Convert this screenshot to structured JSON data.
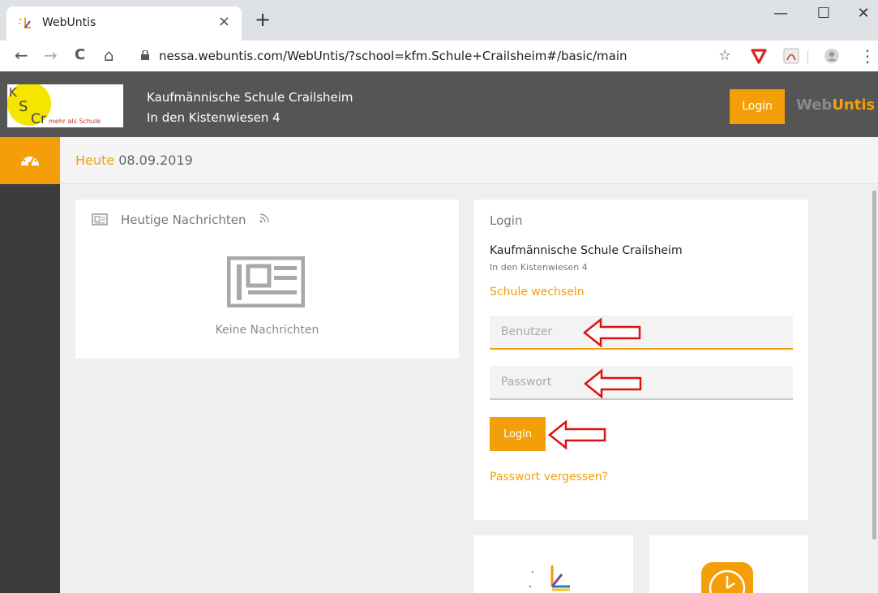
{
  "browser": {
    "tab_title": "WebUntis",
    "tab_close": "×",
    "new_tab": "+",
    "url": "nessa.webuntis.com/WebUntis/?school=kfm.Schule+Crailsheim#/basic/main",
    "window_minimize": "—",
    "window_maximize": "☐",
    "window_close": "✕",
    "nav_back": "←",
    "nav_forward": "→",
    "nav_reload": "C",
    "nav_home": "⌂",
    "bookmark_star": "☆",
    "menu": "⋮"
  },
  "header": {
    "logo_text": "mehr als Schule",
    "logo_letters": [
      "K",
      "S",
      "Cr"
    ],
    "school_name": "Kaufmännische Schule Crailsheim",
    "school_street": "In den Kistenwiesen 4",
    "login_label": "Login",
    "brand_prefix": "Web",
    "brand_accent": "Untis"
  },
  "date_bar": {
    "label": "Heute",
    "date": "08.09.2019"
  },
  "news": {
    "title": "Heutige Nachrichten",
    "empty_text": "Keine Nachrichten"
  },
  "login": {
    "title": "Login",
    "school_name": "Kaufmännische Schule Crailsheim",
    "school_street": "In den Kistenwiesen 4",
    "switch_school": "Schule wechseln",
    "username_placeholder": "Benutzer",
    "password_placeholder": "Passwort",
    "submit_label": "Login",
    "forgot_password": "Passwort vergessen?"
  },
  "colors": {
    "accent": "#f49f0a",
    "header_bg": "#555555",
    "sidebar_bg": "#3c3c3c",
    "annotation_arrow": "#e01010"
  },
  "icons": [
    "webuntis-favicon",
    "lock-icon",
    "star-icon",
    "shield-extension-icon",
    "pdf-extension-icon",
    "profile-icon",
    "dashboard-icon",
    "newspaper-icon",
    "rss-icon",
    "clock-icon"
  ]
}
